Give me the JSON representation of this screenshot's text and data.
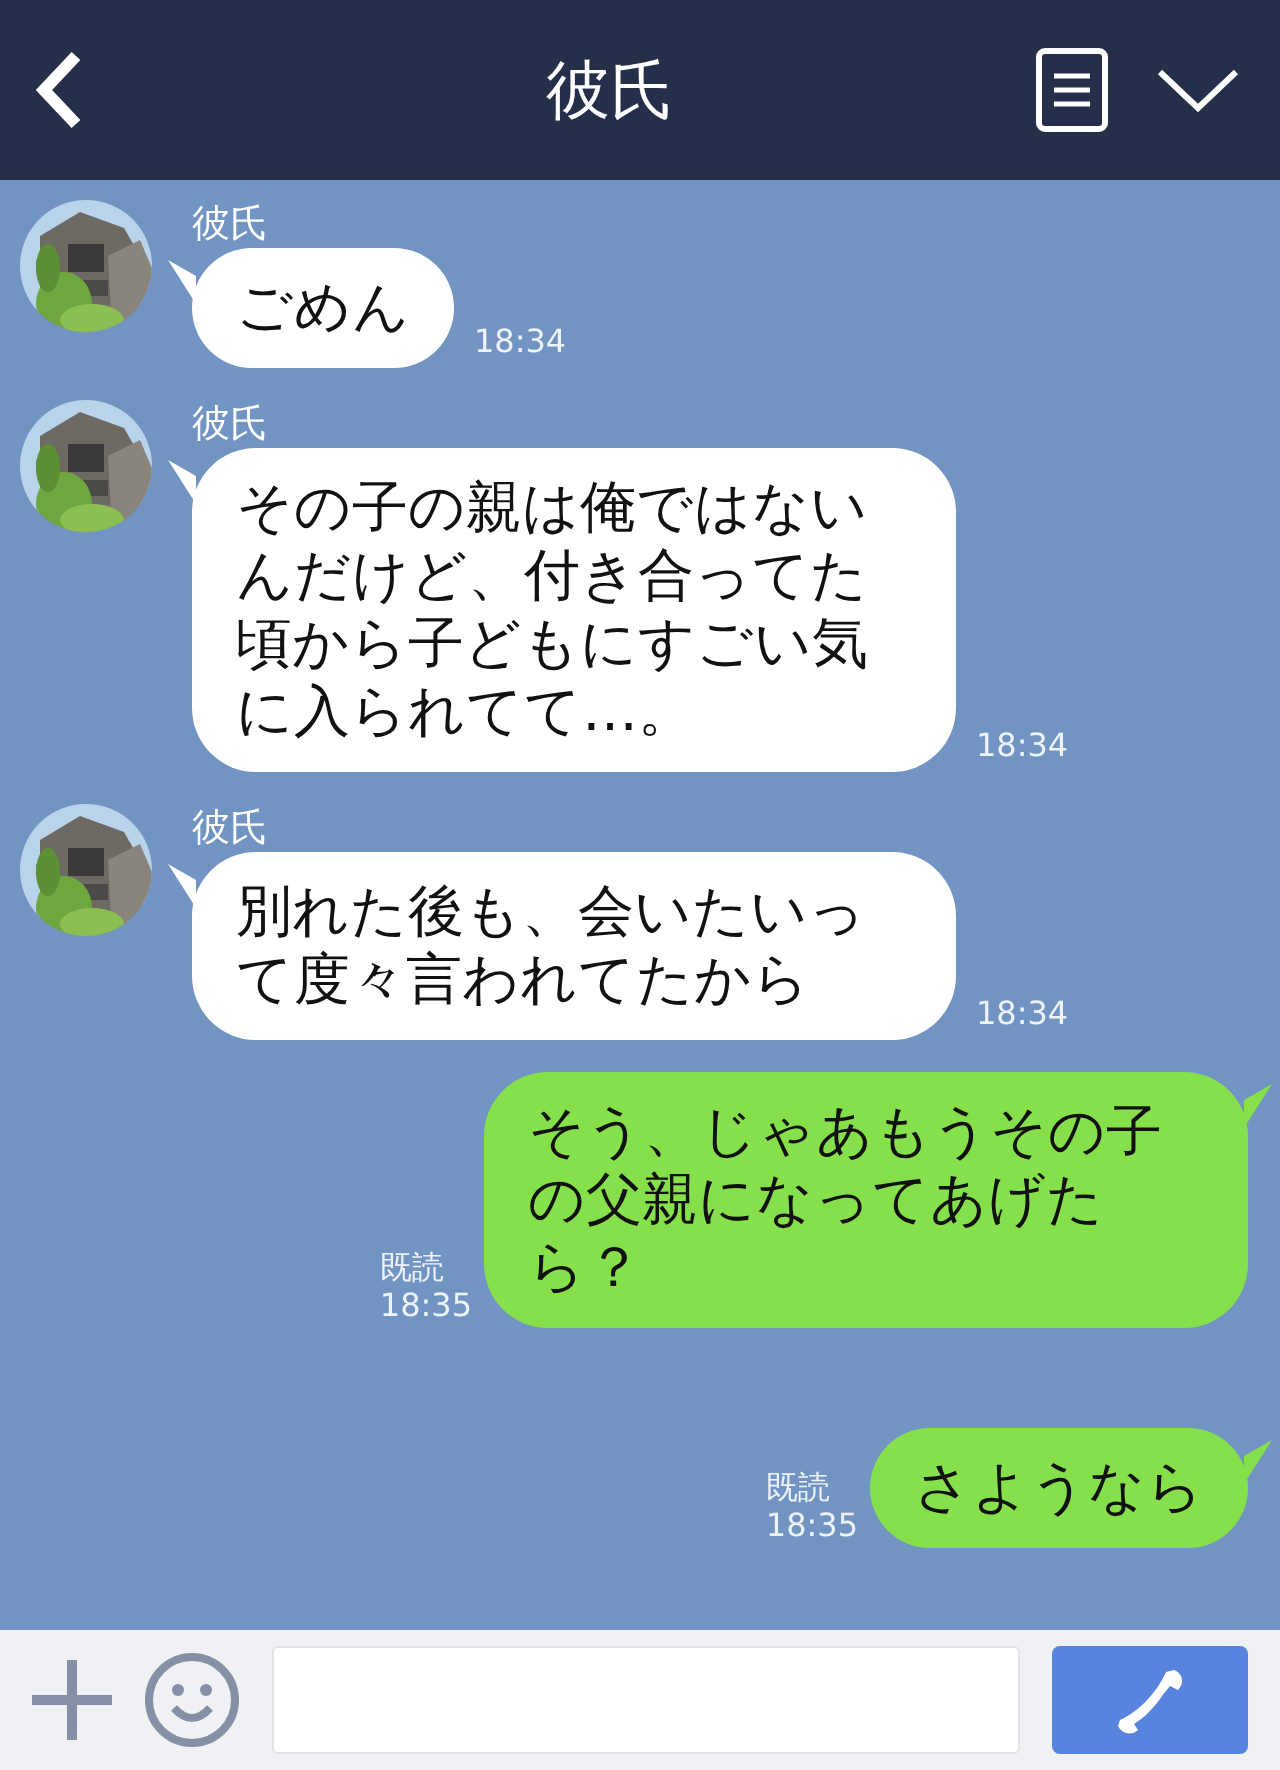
{
  "header": {
    "title": "彼氏"
  },
  "messages": [
    {
      "kind": "incoming",
      "sender": "彼氏",
      "text": "ごめん",
      "time": "18:34"
    },
    {
      "kind": "incoming",
      "sender": "彼氏",
      "text": "その子の親は俺ではないんだけど、付き合ってた頃から子どもにすごい気に入られてて…。",
      "time": "18:34"
    },
    {
      "kind": "incoming",
      "sender": "彼氏",
      "text": "別れた後も、会いたいって度々言われてたから",
      "time": "18:34"
    },
    {
      "kind": "outgoing",
      "read": "既読",
      "text": "そう、じゃあもうその子の父親になってあげたら？",
      "time": "18:35"
    },
    {
      "kind": "outgoing",
      "read": "既読",
      "text": "さようなら",
      "time": "18:35"
    }
  ]
}
